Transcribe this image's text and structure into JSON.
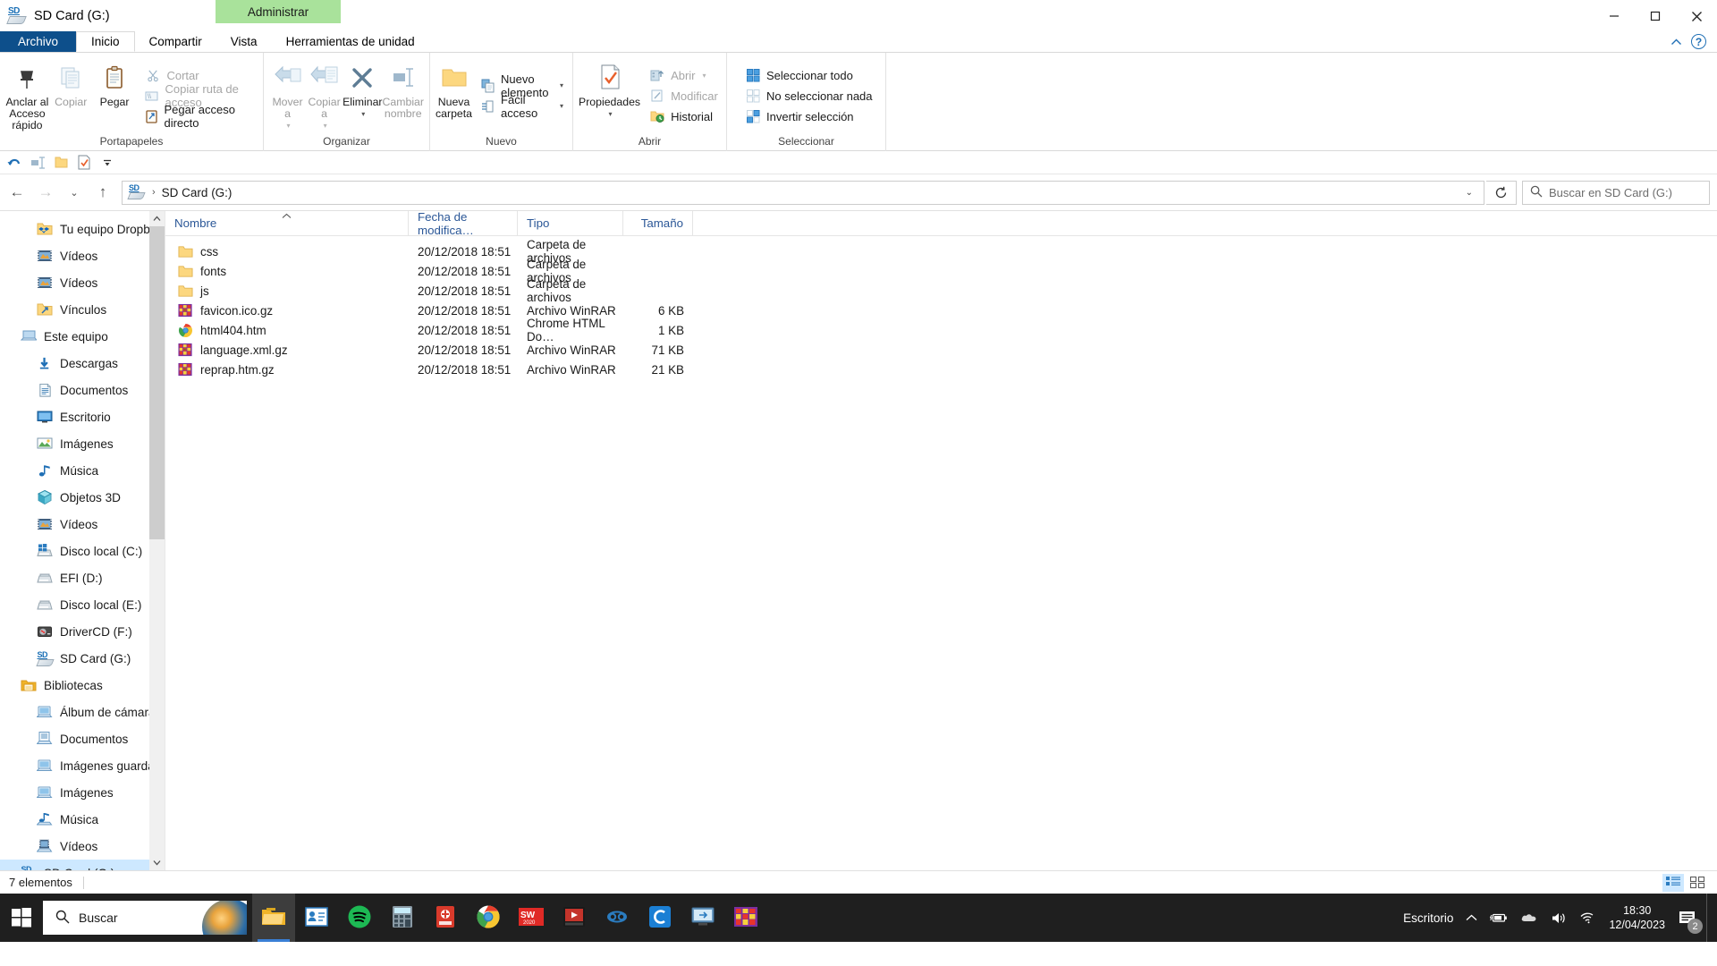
{
  "window": {
    "title": "SD Card (G:)",
    "icon": "sd-card-icon",
    "contextual_tab_group": "Administrar",
    "minimize_label": "Minimizar",
    "maximize_label": "Maximizar",
    "close_label": "Cerrar"
  },
  "ribbon": {
    "tabs": [
      {
        "label": "Archivo",
        "kind": "file"
      },
      {
        "label": "Inicio",
        "kind": "active"
      },
      {
        "label": "Compartir",
        "kind": "normal"
      },
      {
        "label": "Vista",
        "kind": "normal"
      },
      {
        "label": "Herramientas de unidad",
        "kind": "tool"
      }
    ],
    "collapse_label": "Contraer la cinta de opciones",
    "help_label": "?",
    "groups": [
      {
        "title": "Portapapeles",
        "big_buttons": [
          {
            "label": "Anclar al\nAcceso rápido",
            "icon": "pin-icon",
            "dim": false
          },
          {
            "label": "Copiar",
            "icon": "copy-icon",
            "dim": true
          },
          {
            "label": "Pegar",
            "icon": "paste-icon",
            "dim": false
          }
        ],
        "small_buttons": [
          {
            "label": "Cortar",
            "icon": "scissors-icon",
            "dim": true
          },
          {
            "label": "Copiar ruta de acceso",
            "icon": "copy-path-icon",
            "dim": true
          },
          {
            "label": "Pegar acceso directo",
            "icon": "paste-shortcut-icon",
            "dim": false
          }
        ]
      },
      {
        "title": "Organizar",
        "big_buttons": [
          {
            "label": "Mover\na",
            "icon": "move-to-icon",
            "dim": true,
            "caret": true
          },
          {
            "label": "Copiar\na",
            "icon": "copy-to-icon",
            "dim": true,
            "caret": true
          },
          {
            "label": "Eliminar",
            "icon": "delete-icon",
            "dim": false,
            "caret": true
          },
          {
            "label": "Cambiar\nnombre",
            "icon": "rename-icon",
            "dim": true
          }
        ]
      },
      {
        "title": "Nuevo",
        "big_buttons": [
          {
            "label": "Nueva\ncarpeta",
            "icon": "new-folder-icon",
            "dim": false
          }
        ],
        "small_buttons": [
          {
            "label": "Nuevo elemento",
            "icon": "new-item-icon",
            "dim": false,
            "caret": true
          },
          {
            "label": "Fácil acceso",
            "icon": "easy-access-icon",
            "dim": false,
            "caret": true
          }
        ]
      },
      {
        "title": "Abrir",
        "big_buttons": [
          {
            "label": "Propiedades",
            "icon": "properties-icon",
            "dim": false,
            "caret": true
          }
        ],
        "small_buttons": [
          {
            "label": "Abrir",
            "icon": "open-icon",
            "dim": true,
            "caret": true
          },
          {
            "label": "Modificar",
            "icon": "edit-icon",
            "dim": true
          },
          {
            "label": "Historial",
            "icon": "history-icon",
            "dim": false
          }
        ]
      },
      {
        "title": "Seleccionar",
        "small_buttons": [
          {
            "label": "Seleccionar todo",
            "icon": "select-all-icon",
            "dim": false
          },
          {
            "label": "No seleccionar nada",
            "icon": "select-none-icon",
            "dim": false
          },
          {
            "label": "Invertir selección",
            "icon": "invert-selection-icon",
            "dim": false
          }
        ]
      }
    ]
  },
  "quick_access": {
    "buttons": [
      {
        "name": "undo-icon",
        "label": "Deshacer"
      },
      {
        "name": "rename-icon",
        "label": "Cambiar nombre"
      },
      {
        "name": "new-folder-icon",
        "label": "Nueva carpeta"
      },
      {
        "name": "properties-icon",
        "label": "Propiedades"
      },
      {
        "name": "customize-caret-icon",
        "label": "Personalizar barra de herramientas de acceso rápido"
      }
    ]
  },
  "address_bar": {
    "back_label": "Atrás",
    "forward_label": "Adelante",
    "recent_label": "Ubicaciones recientes",
    "up_label": "Subir un nivel",
    "path_icon": "sd-card-icon",
    "crumbs": [
      "SD Card (G:)"
    ],
    "dropdown_caret": "⌄",
    "refresh_label": "Actualizar",
    "search_placeholder": "Buscar en SD Card (G:)",
    "search_value": ""
  },
  "navigation_pane": {
    "items": [
      {
        "label": "Tu equipo Dropbox",
        "icon": "dropbox-folder-icon",
        "indent": 1,
        "selected": false
      },
      {
        "label": "Vídeos",
        "icon": "videos-icon",
        "indent": 1,
        "selected": false
      },
      {
        "label": "Vídeos",
        "icon": "videos-icon",
        "indent": 1,
        "selected": false
      },
      {
        "label": "Vínculos",
        "icon": "links-folder-icon",
        "indent": 1,
        "selected": false
      },
      {
        "label": "Este equipo",
        "icon": "this-pc-icon",
        "indent": 0,
        "selected": false
      },
      {
        "label": "Descargas",
        "icon": "downloads-icon",
        "indent": 1,
        "selected": false
      },
      {
        "label": "Documentos",
        "icon": "documents-icon",
        "indent": 1,
        "selected": false
      },
      {
        "label": "Escritorio",
        "icon": "desktop-icon",
        "indent": 1,
        "selected": false
      },
      {
        "label": "Imágenes",
        "icon": "pictures-icon",
        "indent": 1,
        "selected": false
      },
      {
        "label": "Música",
        "icon": "music-icon",
        "indent": 1,
        "selected": false
      },
      {
        "label": "Objetos 3D",
        "icon": "3d-objects-icon",
        "indent": 1,
        "selected": false
      },
      {
        "label": "Vídeos",
        "icon": "videos-icon",
        "indent": 1,
        "selected": false
      },
      {
        "label": "Disco local (C:)",
        "icon": "system-drive-icon",
        "indent": 1,
        "selected": false
      },
      {
        "label": "EFI (D:)",
        "icon": "drive-icon",
        "indent": 1,
        "selected": false
      },
      {
        "label": "Disco local (E:)",
        "icon": "drive-icon",
        "indent": 1,
        "selected": false
      },
      {
        "label": "DriverCD (F:)",
        "icon": "cd-drive-icon",
        "indent": 1,
        "selected": false
      },
      {
        "label": "SD Card (G:)",
        "icon": "sd-card-icon",
        "indent": 1,
        "selected": false
      },
      {
        "label": "Bibliotecas",
        "icon": "libraries-icon",
        "indent": 0,
        "selected": false
      },
      {
        "label": "Álbum de cámara",
        "icon": "library-icon",
        "indent": 1,
        "selected": false
      },
      {
        "label": "Documentos",
        "icon": "library-docs-icon",
        "indent": 1,
        "selected": false
      },
      {
        "label": "Imágenes guardadas",
        "icon": "library-icon",
        "indent": 1,
        "selected": false
      },
      {
        "label": "Imágenes",
        "icon": "library-icon",
        "indent": 1,
        "selected": false
      },
      {
        "label": "Música",
        "icon": "library-music-icon",
        "indent": 1,
        "selected": false
      },
      {
        "label": "Vídeos",
        "icon": "library-video-icon",
        "indent": 1,
        "selected": false
      },
      {
        "label": "SD Card (G:)",
        "icon": "sd-card-icon",
        "indent": 0,
        "selected": true
      }
    ]
  },
  "file_list": {
    "columns": [
      {
        "label": "Nombre",
        "sorted": true,
        "sort_dir": "asc"
      },
      {
        "label": "Fecha de modifica…",
        "sorted": false
      },
      {
        "label": "Tipo",
        "sorted": false
      },
      {
        "label": "Tamaño",
        "sorted": false
      }
    ],
    "rows": [
      {
        "name": "css",
        "date": "20/12/2018 18:51",
        "type": "Carpeta de archivos",
        "size": "",
        "icon": "folder-icon"
      },
      {
        "name": "fonts",
        "date": "20/12/2018 18:51",
        "type": "Carpeta de archivos",
        "size": "",
        "icon": "folder-icon"
      },
      {
        "name": "js",
        "date": "20/12/2018 18:51",
        "type": "Carpeta de archivos",
        "size": "",
        "icon": "folder-icon"
      },
      {
        "name": "favicon.ico.gz",
        "date": "20/12/2018 18:51",
        "type": "Archivo WinRAR",
        "size": "6 KB",
        "icon": "winrar-icon"
      },
      {
        "name": "html404.htm",
        "date": "20/12/2018 18:51",
        "type": "Chrome HTML Do…",
        "size": "1 KB",
        "icon": "chrome-icon"
      },
      {
        "name": "language.xml.gz",
        "date": "20/12/2018 18:51",
        "type": "Archivo WinRAR",
        "size": "71 KB",
        "icon": "winrar-icon"
      },
      {
        "name": "reprap.htm.gz",
        "date": "20/12/2018 18:51",
        "type": "Archivo WinRAR",
        "size": "21 KB",
        "icon": "winrar-icon"
      }
    ]
  },
  "status_bar": {
    "item_count": "7 elementos",
    "view_details_label": "Detalles",
    "view_large_icons_label": "Iconos grandes"
  },
  "taskbar": {
    "start_label": "Inicio",
    "search_placeholder": "Buscar",
    "apps": [
      {
        "name": "file-explorer-icon",
        "label": "Explorador de archivos",
        "active": true
      },
      {
        "name": "contacts-icon",
        "label": "Contactos",
        "active": false
      },
      {
        "name": "spotify-icon",
        "label": "Spotify",
        "active": false
      },
      {
        "name": "calculator-icon",
        "label": "Calculadora",
        "active": false
      },
      {
        "name": "antivirus-icon",
        "label": "Antivirus",
        "active": false
      },
      {
        "name": "chrome-icon",
        "label": "Google Chrome",
        "active": false
      },
      {
        "name": "solidworks-icon",
        "label": "SolidWorks 2020",
        "active": false
      },
      {
        "name": "media-player-icon",
        "label": "Reproductor",
        "active": false
      },
      {
        "name": "tool-icon",
        "label": "Herramienta",
        "active": false
      },
      {
        "name": "c-app-icon",
        "label": "Aplicación C",
        "active": false
      },
      {
        "name": "remote-desktop-icon",
        "label": "Escritorio remoto",
        "active": false
      },
      {
        "name": "winrar-icon",
        "label": "WinRAR",
        "active": false
      }
    ],
    "tray": {
      "desktop_label": "Escritorio",
      "overflow_label": "Mostrar iconos ocultos",
      "battery_label": "Batería",
      "onedrive_label": "OneDrive",
      "volume_label": "Volumen",
      "network_label": "Red",
      "time": "18:30",
      "date": "12/04/2023",
      "notification_count": "2"
    }
  },
  "colors": {
    "file_tab_blue": "#0d4f8b",
    "contextual_green": "#a9e29b",
    "column_header_blue": "#2b5797",
    "selection_blue": "#cde8ff",
    "taskbar_dark": "#1f1f1f"
  }
}
